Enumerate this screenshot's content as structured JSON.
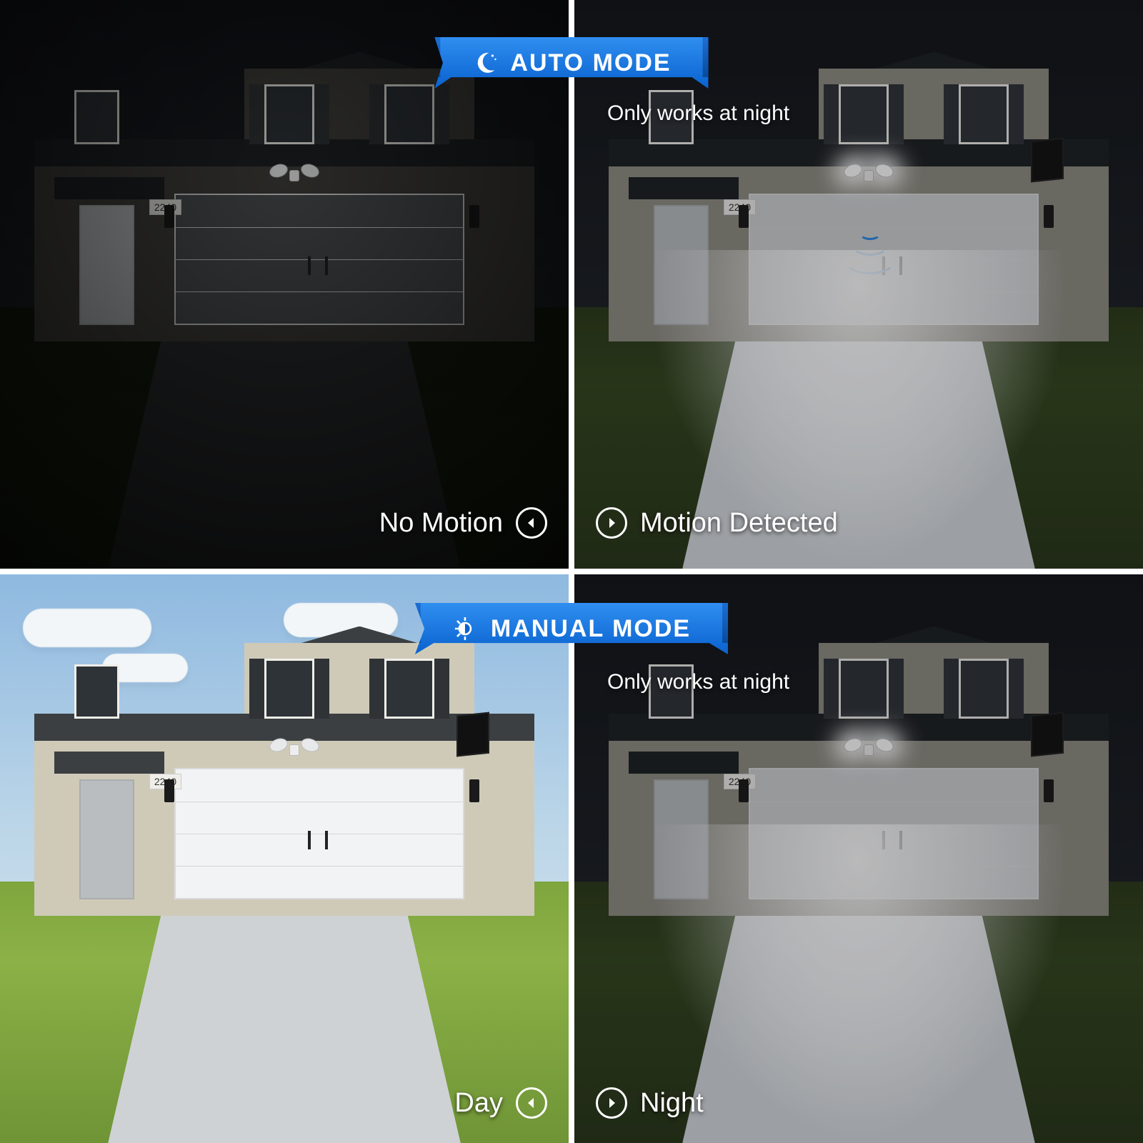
{
  "house_number": "2240",
  "banners": {
    "auto": {
      "label": "AUTO MODE",
      "icon": "moon-icon"
    },
    "manual": {
      "label": "MANUAL MODE",
      "icon": "half-sun-icon"
    }
  },
  "subtitles": {
    "auto": "Only works at night",
    "manual": "Only works at night"
  },
  "captions": {
    "top_left": "No Motion",
    "top_right": "Motion Detected",
    "bot_left": "Day",
    "bot_right": "Night"
  },
  "panels": {
    "top_left": {
      "time": "night",
      "lights_on": false,
      "motion": false
    },
    "top_right": {
      "time": "night",
      "lights_on": true,
      "motion": true
    },
    "bot_left": {
      "time": "day",
      "lights_on": false,
      "motion": false
    },
    "bot_right": {
      "time": "night",
      "lights_on": true,
      "motion": false
    }
  },
  "colors": {
    "banner_blue": "#1d7ae5",
    "motion_blue": "#2a8be6"
  }
}
